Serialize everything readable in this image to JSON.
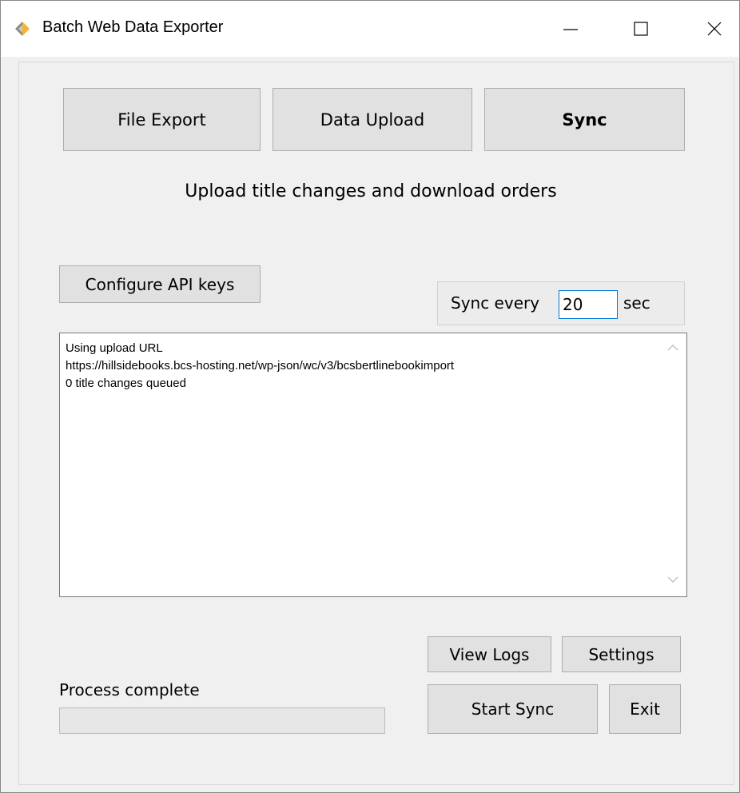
{
  "window": {
    "title": "Batch Web Data Exporter",
    "icons": {
      "app": "app-diamond-icon",
      "minimize": "minimize-icon",
      "maximize": "maximize-icon",
      "close": "close-icon"
    }
  },
  "tabs": [
    {
      "label": "File Export",
      "active": false
    },
    {
      "label": "Data Upload",
      "active": false
    },
    {
      "label": "Sync",
      "active": true
    }
  ],
  "subtitle": "Upload title changes and download orders",
  "buttons": {
    "configure_api": "Configure API keys",
    "view_logs": "View Logs",
    "settings": "Settings",
    "start_sync": "Start Sync",
    "exit": "Exit"
  },
  "sync": {
    "label": "Sync every",
    "value": "20",
    "unit": "sec"
  },
  "log": {
    "lines": [
      "Using upload URL",
      "https://hillsidebooks.bcs-hosting.net/wp-json/wc/v3/bcsbertlinebookimport",
      "0 title changes queued"
    ]
  },
  "status": {
    "text": "Process complete",
    "progress": 0
  },
  "colors": {
    "accent": "#0078d7",
    "button_bg": "#e1e1e1",
    "button_border": "#adadad",
    "progress_fill": "#06b025"
  }
}
